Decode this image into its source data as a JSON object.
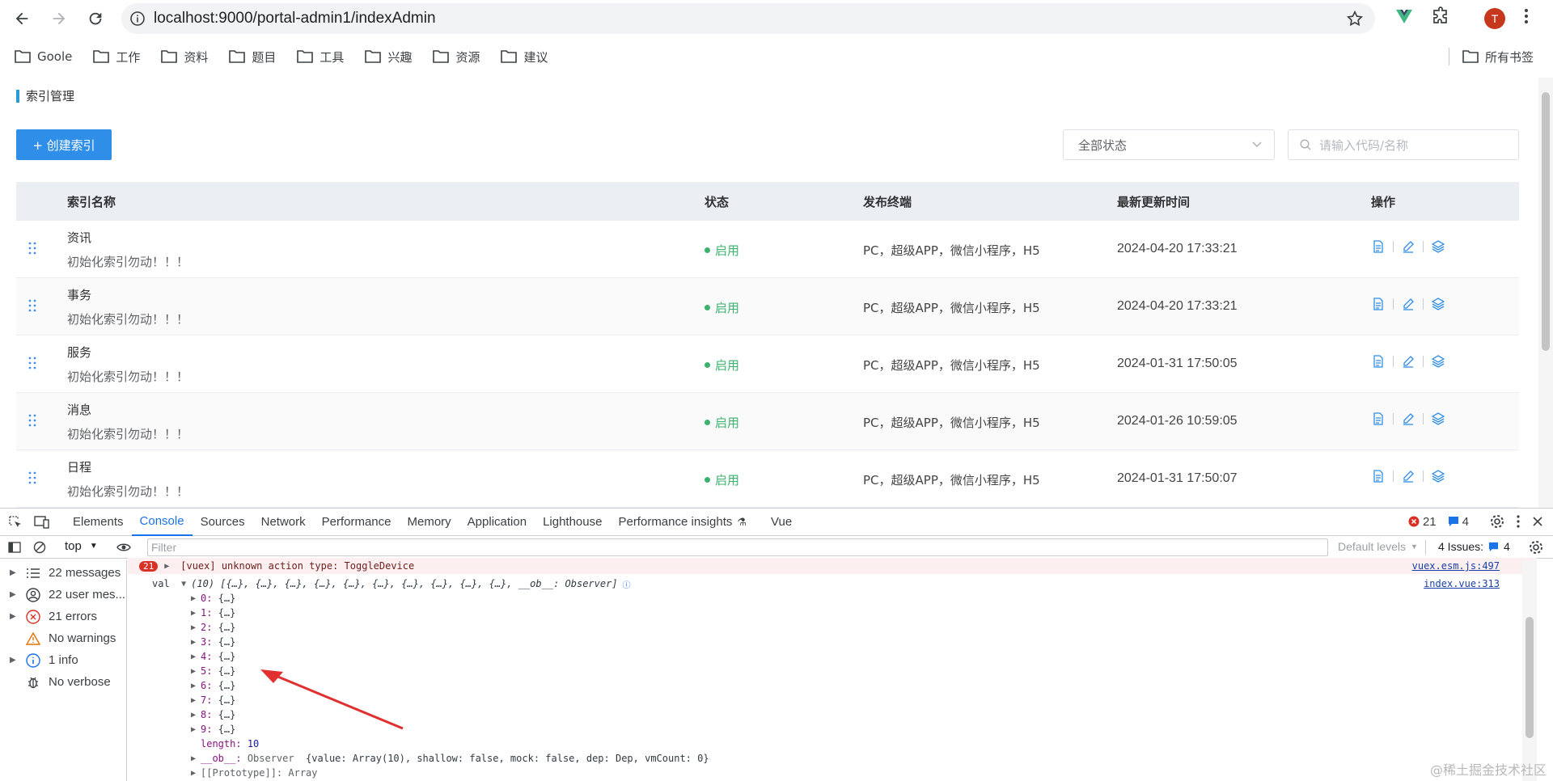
{
  "browser": {
    "url": "localhost:9000/portal-admin1/indexAdmin",
    "avatar_letter": "T",
    "bookmarks": [
      "Goole",
      "工作",
      "资料",
      "题目",
      "工具",
      "兴趣",
      "资源",
      "建议"
    ],
    "all_bookmarks": "所有书签"
  },
  "page": {
    "breadcrumb": "索引管理",
    "create_button": "+ 创建索引",
    "status_select": "全部状态",
    "search_placeholder": "请输入代码/名称",
    "table": {
      "headers": [
        "索引名称",
        "状态",
        "发布终端",
        "最新更新时间",
        "操作"
      ],
      "rows": [
        {
          "name": "资讯",
          "desc": "初始化索引勿动！！！",
          "status": "启用",
          "terminals": "PC，超级APP，微信小程序，H5",
          "time": "2024-04-20 17:33:21"
        },
        {
          "name": "事务",
          "desc": "初始化索引勿动！！！",
          "status": "启用",
          "terminals": "PC，超级APP，微信小程序，H5",
          "time": "2024-04-20 17:33:21"
        },
        {
          "name": "服务",
          "desc": "初始化索引勿动！！！",
          "status": "启用",
          "terminals": "PC，超级APP，微信小程序，H5",
          "time": "2024-01-31 17:50:05"
        },
        {
          "name": "消息",
          "desc": "初始化索引勿动！！！",
          "status": "启用",
          "terminals": "PC，超级APP，微信小程序，H5",
          "time": "2024-01-26 10:59:05"
        },
        {
          "name": "日程",
          "desc": "初始化索引勿动！！！",
          "status": "启用",
          "terminals": "PC，超级APP，微信小程序，H5",
          "time": "2024-01-31 17:50:07"
        }
      ]
    }
  },
  "devtools": {
    "tabs": [
      "Elements",
      "Console",
      "Sources",
      "Network",
      "Performance",
      "Memory",
      "Application",
      "Lighthouse",
      "Performance insights",
      "Vue"
    ],
    "active_tab": "Console",
    "error_count": "21",
    "issue_count": "4",
    "context": "top",
    "filter_placeholder": "Filter",
    "levels": "Default levels",
    "issues_label": "4 Issues:",
    "issues_count": "4",
    "sidebar": [
      {
        "label": "22 messages",
        "icon": "list-icon"
      },
      {
        "label": "22 user mes...",
        "icon": "user-icon"
      },
      {
        "label": "21 errors",
        "icon": "error-icon"
      },
      {
        "label": "No warnings",
        "icon": "warning-icon"
      },
      {
        "label": "1 info",
        "icon": "info-icon"
      },
      {
        "label": "No verbose",
        "icon": "bug-icon"
      }
    ],
    "console": {
      "error_badge": "21",
      "error_text": "[vuex] unknown action type: ToggleDevice",
      "error_link": "vuex.esm.js:497",
      "val_label": "val",
      "val_summary": "(10) [{…}, {…}, {…}, {…}, {…}, {…}, {…}, {…}, {…}, {…}, __ob__: Observer]",
      "val_link": "index.vue:313",
      "items": [
        "0",
        "1",
        "2",
        "3",
        "4",
        "5",
        "6",
        "7",
        "8",
        "9"
      ],
      "item_value": "{…}",
      "length_key": "length",
      "length_value": "10",
      "ob_key": "__ob__",
      "ob_value": "Observer",
      "ob_detail": "{value: Array(10), shallow: false, mock: false, dep: Dep, vmCount: 0}",
      "proto": "[[Prototype]]: Array"
    }
  },
  "watermark": "@稀土掘金技术社区",
  "colors": {
    "accent": "#2f8ee8",
    "status_green": "#3bb36f",
    "error_red": "#d93025",
    "arrow_red": "#e03030"
  }
}
